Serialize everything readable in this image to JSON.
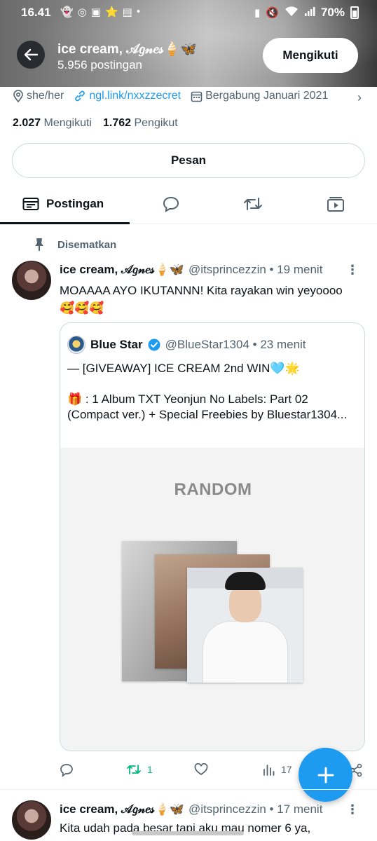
{
  "status_bar": {
    "time": "16.41",
    "battery": "70%",
    "left_icons": [
      "snapchat-icon",
      "whatsapp-icon",
      "linkedin-icon",
      "star-icon",
      "shopping-icon",
      "dot-icon"
    ],
    "right_icons": [
      "sim-icon",
      "mute-icon",
      "wifi-icon",
      "signal-icon",
      "battery-icon"
    ]
  },
  "header": {
    "name": "ice cream, 𝒜𝑔𝓃𝑒𝓈🍦🦋",
    "post_count": "5.956 postingan",
    "follow_button": "Mengikuti"
  },
  "profile": {
    "pronouns": "she/her",
    "link": "ngl.link/nxxzzecret",
    "joined": "Bergabung Januari 2021",
    "following_count": "2.027",
    "following_label": "Mengikuti",
    "followers_count": "1.762",
    "followers_label": "Pengikut",
    "message_button": "Pesan"
  },
  "tabs": {
    "active_label": "Postingan"
  },
  "pinned_post": {
    "pinned_label": "Disematkan",
    "name": "ice cream, 𝒜𝑔𝓃𝑒𝓈🍦🦋",
    "handle_time": "@itsprincezzin • 19 menit",
    "text": "MOAAAA AYO IKUTANNN! Kita rayakan win yeyoooo🥰🥰🥰",
    "quote": {
      "name": "Blue Star",
      "handle_time": "@BlueStar1304 • 23 menit",
      "line1": "— [GIVEAWAY] ICE CREAM 2nd WIN🩵🌟",
      "line2": "🎁 : 1 Album TXT Yeonjun No Labels: Part 02 (Compact ver.) + Special Freebies by Bluestar1304...",
      "image_title": "RANDOM"
    },
    "retweet_count": "1",
    "view_count": "17"
  },
  "second_post": {
    "name": "ice cream, 𝒜𝑔𝓃𝑒𝓈🍦🦋",
    "handle_time": "@itsprincezzin • 17 menit",
    "text": "Kita udah pada besar tapi aku mau nomer 6 ya,"
  },
  "colors": {
    "accent": "#1d9bf0",
    "retweet_green": "#00ba7c",
    "text_primary": "#0f1419",
    "text_secondary": "#536471"
  }
}
